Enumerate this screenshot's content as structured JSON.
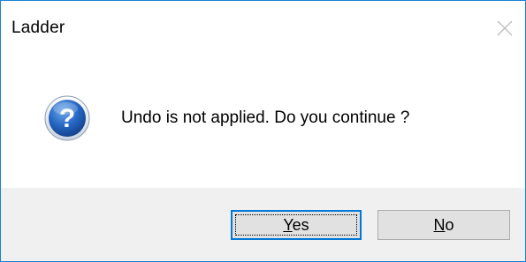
{
  "dialog": {
    "title": "Ladder",
    "message": "Undo is not applied. Do you continue ?",
    "icon": "question-icon",
    "buttons": {
      "yes": {
        "mnemonic": "Y",
        "rest": "es"
      },
      "no": {
        "mnemonic": "N",
        "rest": "o"
      }
    },
    "colors": {
      "border": "#1883d7",
      "footer_bg": "#f0f0f0",
      "button_bg": "#e1e1e1",
      "default_button_border": "#0078d7"
    }
  }
}
